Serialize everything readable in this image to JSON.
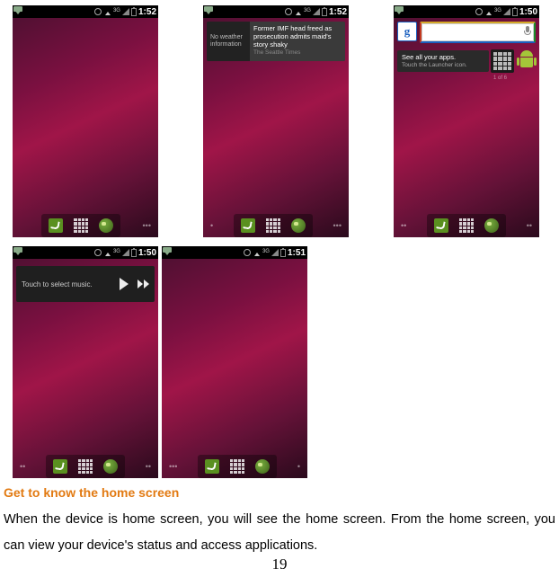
{
  "screenshots": {
    "s1": {
      "clock": "1:52"
    },
    "s2": {
      "clock": "1:52",
      "news_no_weather": "No weather information",
      "news_title": "Former IMF head freed as prosecution admits maid's story shaky",
      "news_source": "The Seattle Times"
    },
    "s3": {
      "clock": "1:50",
      "search_letter": "g",
      "tips_title": "See all your apps.",
      "tips_sub": "Touch the Launcher icon.",
      "tips_count": "1 of 6"
    },
    "s4": {
      "clock": "1:50",
      "music_label": "Touch to select music."
    },
    "s5": {
      "clock": "1:51"
    }
  },
  "doc": {
    "heading": "Get to know the home screen",
    "paragraph": "When the device is home screen, you will see the home screen. From the home screen, you can view your device's status and access applications.",
    "page_number": "19"
  }
}
